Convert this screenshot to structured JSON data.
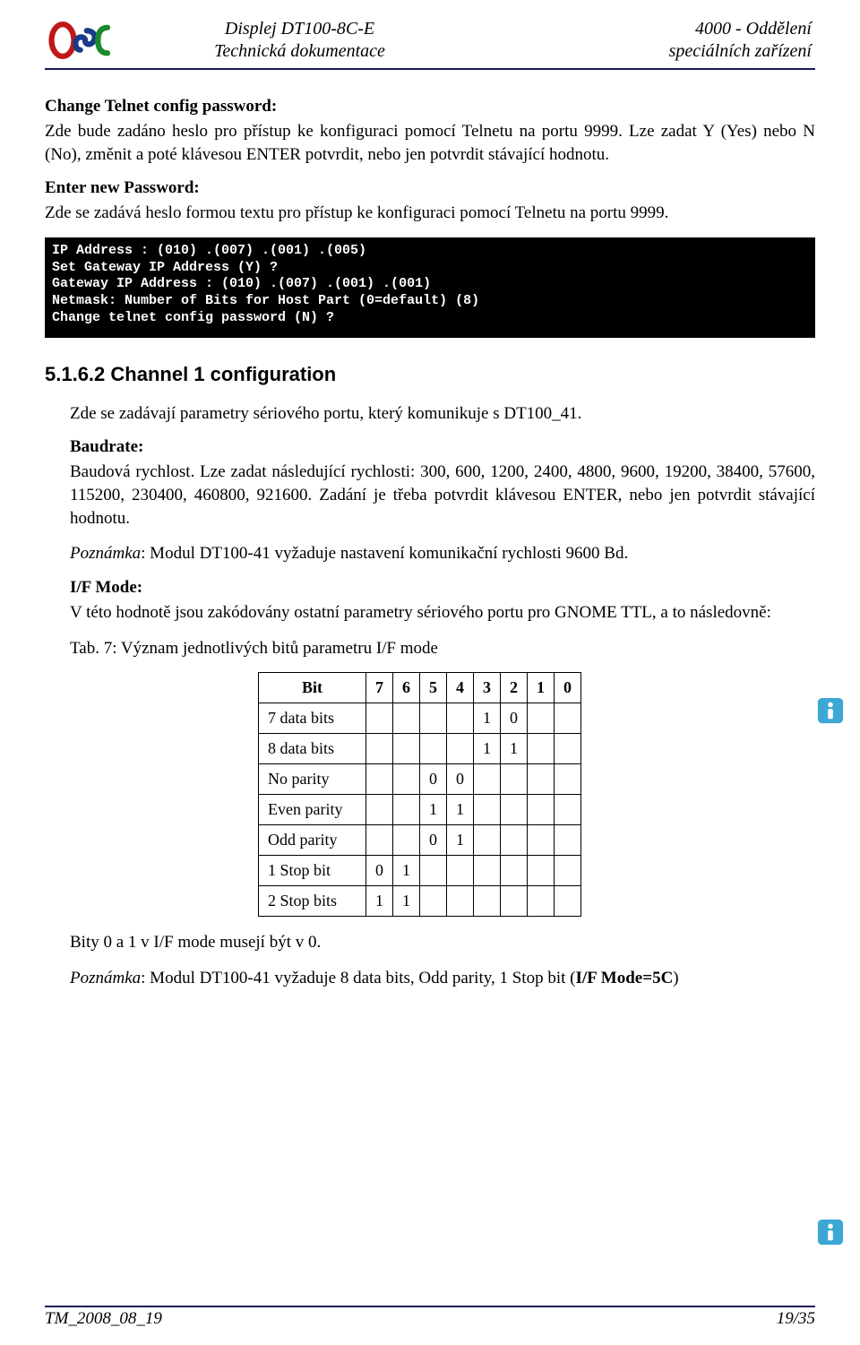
{
  "header": {
    "left_line1": "Displej DT100-8C-E",
    "left_line2": "Technická dokumentace",
    "right_line1": "4000 - Oddělení",
    "right_line2": "speciálních zařízení"
  },
  "body": {
    "p1_title": "Change Telnet config password:",
    "p1_text": "Zde bude zadáno heslo pro přístup ke konfiguraci pomocí Telnetu na portu 9999. Lze zadat Y (Yes) nebo N (No), změnit a poté klávesou ENTER potvrdit, nebo jen potvrdit stávající hodnotu.",
    "p2_title": "Enter new Password:",
    "p2_text": "Zde se zadává heslo formou textu pro přístup ke konfiguraci pomocí Telnetu na portu 9999.",
    "terminal": "IP Address : (010) .(007) .(001) .(005)\nSet Gateway IP Address (Y) ?\nGateway IP Address : (010) .(007) .(001) .(001)\nNetmask: Number of Bits for Host Part (0=default) (8)\nChange telnet config password (N) ?",
    "section_heading": "5.1.6.2  Channel 1 configuration",
    "p3_text": "Zde se zadávají parametry sériového portu, který komunikuje s DT100_41.",
    "p4_title": "Baudrate:",
    "p4_text": "Baudová rychlost. Lze zadat následující rychlosti: 300, 600, 1200, 2400, 4800, 9600, 19200, 38400, 57600, 115200, 230400, 460800, 921600. Zadání je třeba potvrdit klávesou ENTER, nebo jen potvrdit stávající hodnotu.",
    "note1_prefix": "Poznámka",
    "note1_text": ": Modul DT100-41 vyžaduje nastavení komunikační rychlosti 9600 Bd.",
    "p5_title": "I/F Mode:",
    "p5_text": "V této hodnotě jsou zakódovány ostatní parametry sériového portu pro GNOME TTL, a to následovně:",
    "table_caption": "Tab. 7: Význam jednotlivých bitů parametru I/F mode",
    "table": {
      "head": [
        "Bit",
        "7",
        "6",
        "5",
        "4",
        "3",
        "2",
        "1",
        "0"
      ],
      "rows": [
        {
          "label": "7 data bits",
          "cells": [
            "",
            "",
            "",
            "",
            "1",
            "0",
            "",
            ""
          ]
        },
        {
          "label": "8 data bits",
          "cells": [
            "",
            "",
            "",
            "",
            "1",
            "1",
            "",
            ""
          ]
        },
        {
          "label": "No parity",
          "cells": [
            "",
            "",
            "0",
            "0",
            "",
            "",
            "",
            ""
          ]
        },
        {
          "label": "Even parity",
          "cells": [
            "",
            "",
            "1",
            "1",
            "",
            "",
            "",
            ""
          ]
        },
        {
          "label": "Odd parity",
          "cells": [
            "",
            "",
            "0",
            "1",
            "",
            "",
            "",
            ""
          ]
        },
        {
          "label": "1 Stop bit",
          "cells": [
            "0",
            "1",
            "",
            "",
            "",
            "",
            "",
            ""
          ]
        },
        {
          "label": "2 Stop bits",
          "cells": [
            "1",
            "1",
            "",
            "",
            "",
            "",
            "",
            ""
          ]
        }
      ]
    },
    "p6_text": "Bity 0 a 1 v I/F mode musejí být v 0.",
    "note2_prefix": "Poznámka",
    "note2_text": ": Modul DT100-41 vyžaduje 8 data bits, Odd parity, 1 Stop bit (",
    "note2_bold": "I/F Mode=5C",
    "note2_close": ")"
  },
  "footer": {
    "left": "TM_2008_08_19",
    "right": "19/35"
  }
}
